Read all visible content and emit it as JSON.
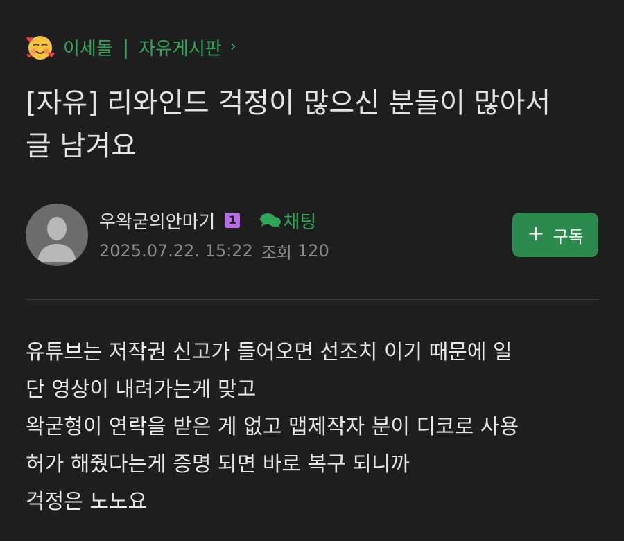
{
  "breadcrumb": {
    "emoji": "smiling-face-with-hearts-icon",
    "user": "이세돌",
    "separator": "|",
    "board": "자유게시판",
    "chevron": "›"
  },
  "post": {
    "title": "[자유] 리와인드 걱정이 많으신 분들이 많아서 글 남겨요",
    "author": "우왁굳의안마기",
    "level_badge": "1",
    "chat_label": "채팅",
    "date": "2025.07.22. 15:22",
    "views_label": "조회",
    "views": "120",
    "subscribe_label": "구독",
    "body_lines": [
      "유튜브는 저작권 신고가 들어오면 선조치 이기 때문에 일",
      "단 영상이 내려가는게 맞고",
      "왁굳형이 연락을 받은 게 없고 맵제작자 분이 디코로 사용",
      "허가 해줬다는게 증명 되면 바로 복구 되니까",
      "걱정은 노노요"
    ]
  },
  "colors": {
    "background": "#1e1e1e",
    "accent_green": "#2fa65a",
    "button_green": "#2c8a4f",
    "badge_purple": "#b56fe0",
    "meta_gray": "#8a8a8a"
  }
}
